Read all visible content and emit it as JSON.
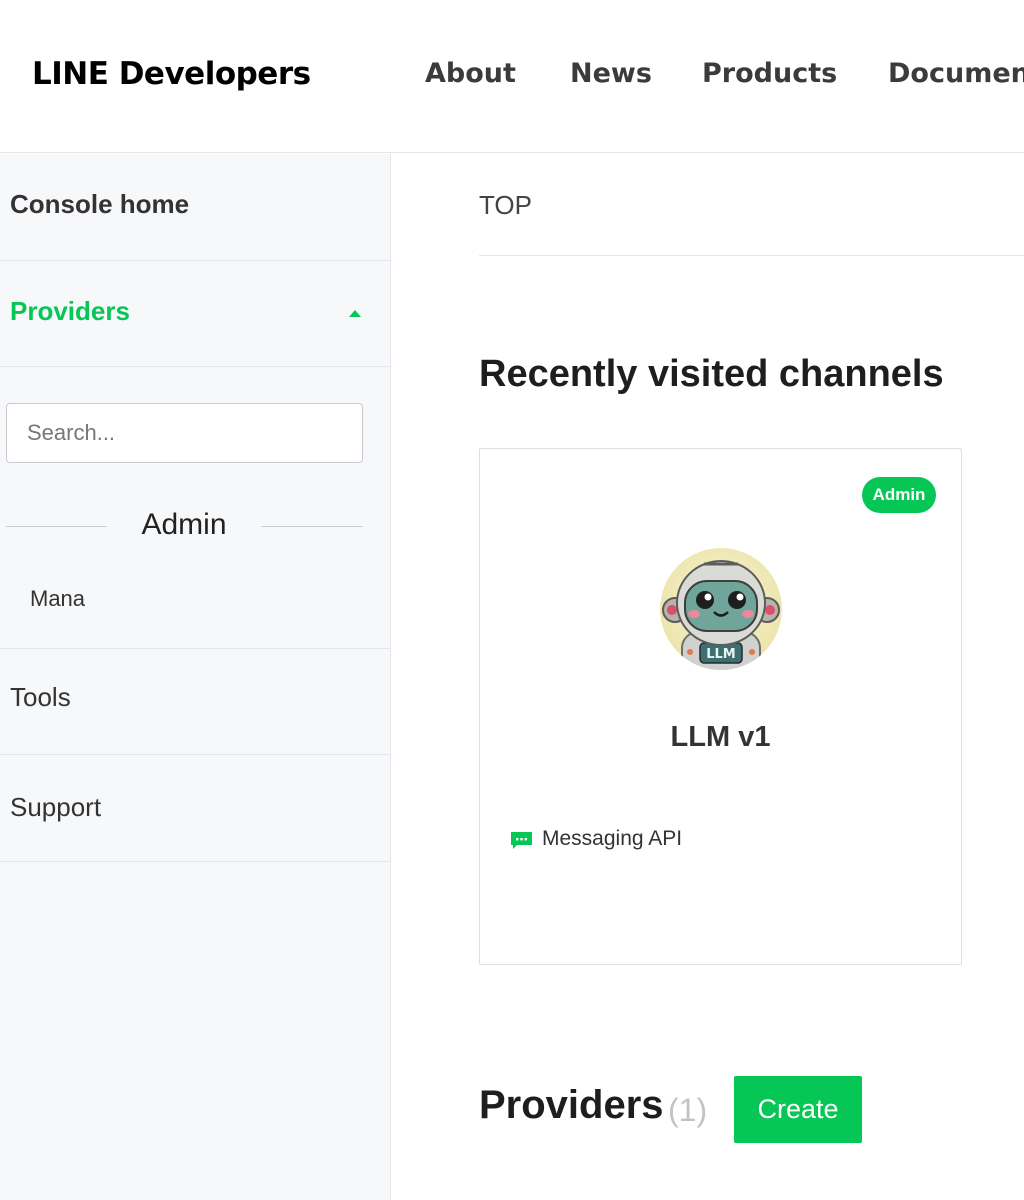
{
  "header": {
    "logo": "LINE Developers",
    "nav": [
      {
        "label": "About"
      },
      {
        "label": "News"
      },
      {
        "label": "Products"
      },
      {
        "label": "Documen"
      }
    ]
  },
  "sidebar": {
    "console_home": "Console home",
    "providers": {
      "label": "Providers",
      "search_placeholder": "Search...",
      "group_label": "Admin",
      "items": [
        "Mana"
      ]
    },
    "tools": "Tools",
    "support": "Support"
  },
  "main": {
    "breadcrumb": "TOP",
    "recent_title": "Recently visited channels",
    "channels": [
      {
        "badge": "Admin",
        "name": "LLM v1",
        "type": "Messaging API",
        "avatar_text": "LLM"
      }
    ],
    "providers_section": {
      "title": "Providers",
      "count": "(1)",
      "create_label": "Create"
    }
  },
  "colors": {
    "accent": "#06c755",
    "sidebar_bg": "#f7f8fa",
    "border": "#e3e6ea"
  },
  "icons": [
    "caret-up-icon",
    "messaging-api-icon"
  ]
}
